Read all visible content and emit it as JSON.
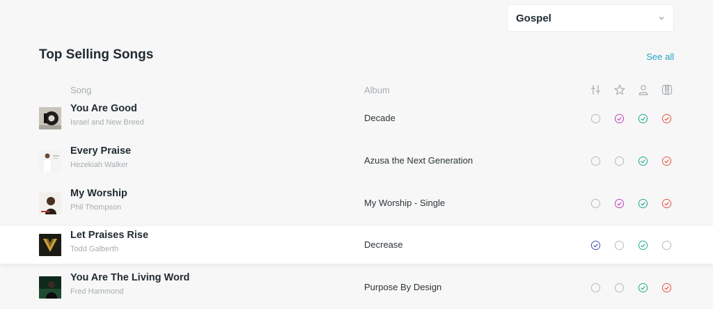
{
  "genre_select": {
    "value": "Gospel",
    "icon": "chevron-down-icon"
  },
  "section": {
    "title": "Top Selling Songs",
    "see_all": "See all"
  },
  "columns": {
    "song": "Song",
    "album": "Album",
    "icons": [
      "sliders-icon",
      "star-icon",
      "person-icon",
      "piano-icon"
    ]
  },
  "colors": {
    "col1": "#3f51b5",
    "col2": "#c03fbf",
    "col3": "#1aaa8c",
    "col4": "#e6523f",
    "unchecked": "#b3b9bd",
    "link": "#23a3c4"
  },
  "songs": [
    {
      "title": "You Are Good",
      "artist": "Israel and New Breed",
      "album": "Decade",
      "status": [
        false,
        true,
        true,
        true
      ]
    },
    {
      "title": "Every Praise",
      "artist": "Hezekiah Walker",
      "album": "Azusa the Next Generation",
      "status": [
        false,
        false,
        true,
        true
      ]
    },
    {
      "title": "My Worship",
      "artist": "Phil Thompson",
      "album": "My Worship - Single",
      "status": [
        false,
        true,
        true,
        true
      ]
    },
    {
      "title": "Let Praises Rise",
      "artist": "Todd Galberth",
      "album": "Decrease",
      "status": [
        true,
        false,
        true,
        false
      ]
    },
    {
      "title": "You Are The Living Word",
      "artist": "Fred Hammond",
      "album": "Purpose By Design",
      "status": [
        false,
        false,
        true,
        true
      ]
    }
  ]
}
